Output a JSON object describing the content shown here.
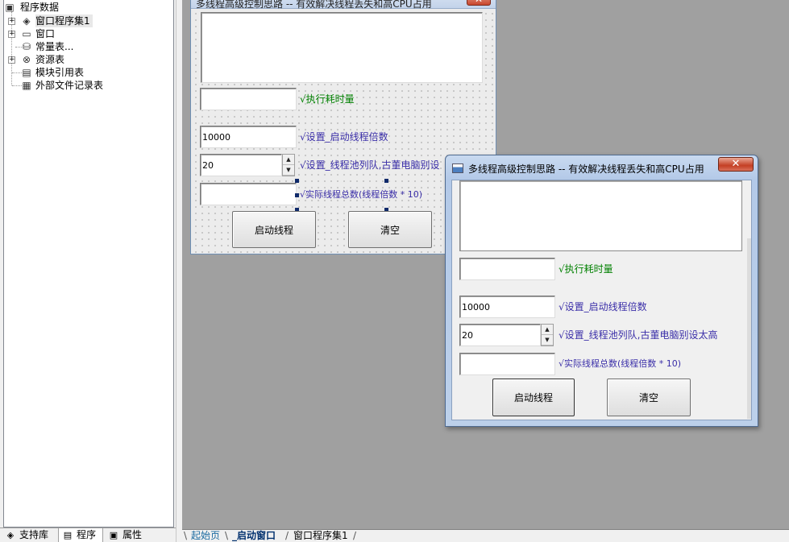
{
  "tree": {
    "root_label": "程序数据",
    "items": [
      {
        "label": "窗口程序集1",
        "icon": "layers-icon",
        "expand": "+"
      },
      {
        "label": "窗口",
        "icon": "window-icon",
        "expand": "+"
      },
      {
        "label": "常量表...",
        "icon": "database-icon",
        "expand": ""
      },
      {
        "label": "资源表",
        "icon": "resource-icon",
        "expand": "+"
      },
      {
        "label": "模块引用表",
        "icon": "module-icon",
        "expand": ""
      },
      {
        "label": "外部文件记录表",
        "icon": "file-icon",
        "expand": ""
      }
    ]
  },
  "left_tabs": {
    "support": "支持库",
    "program": "程序",
    "properties": "属性"
  },
  "doc_tabs": {
    "start": "起始页",
    "start_window": "_启动窗口",
    "assembly": "窗口程序集1"
  },
  "form": {
    "title": "多线程高级控制思路 -- 有效解决线程丢失和高CPU占用",
    "close_glyph": "✕",
    "exec_time_label": "√执行耗时量",
    "multiplier_value": "10000",
    "multiplier_label": "√设置_启动线程倍数",
    "pool_value": "20",
    "pool_label": "√设置_线程池列队,古董电脑别设太高",
    "pool_label_cut": "√设置_线程池列队,古董电脑别设",
    "total_label": "√实际线程总数(线程倍数 * 10)",
    "start_button": "启动线程",
    "clear_button": "清空"
  },
  "colors": {
    "accent_green": "#008000",
    "label_purple": "#3a2ea8",
    "close_red": "#c43f24"
  }
}
